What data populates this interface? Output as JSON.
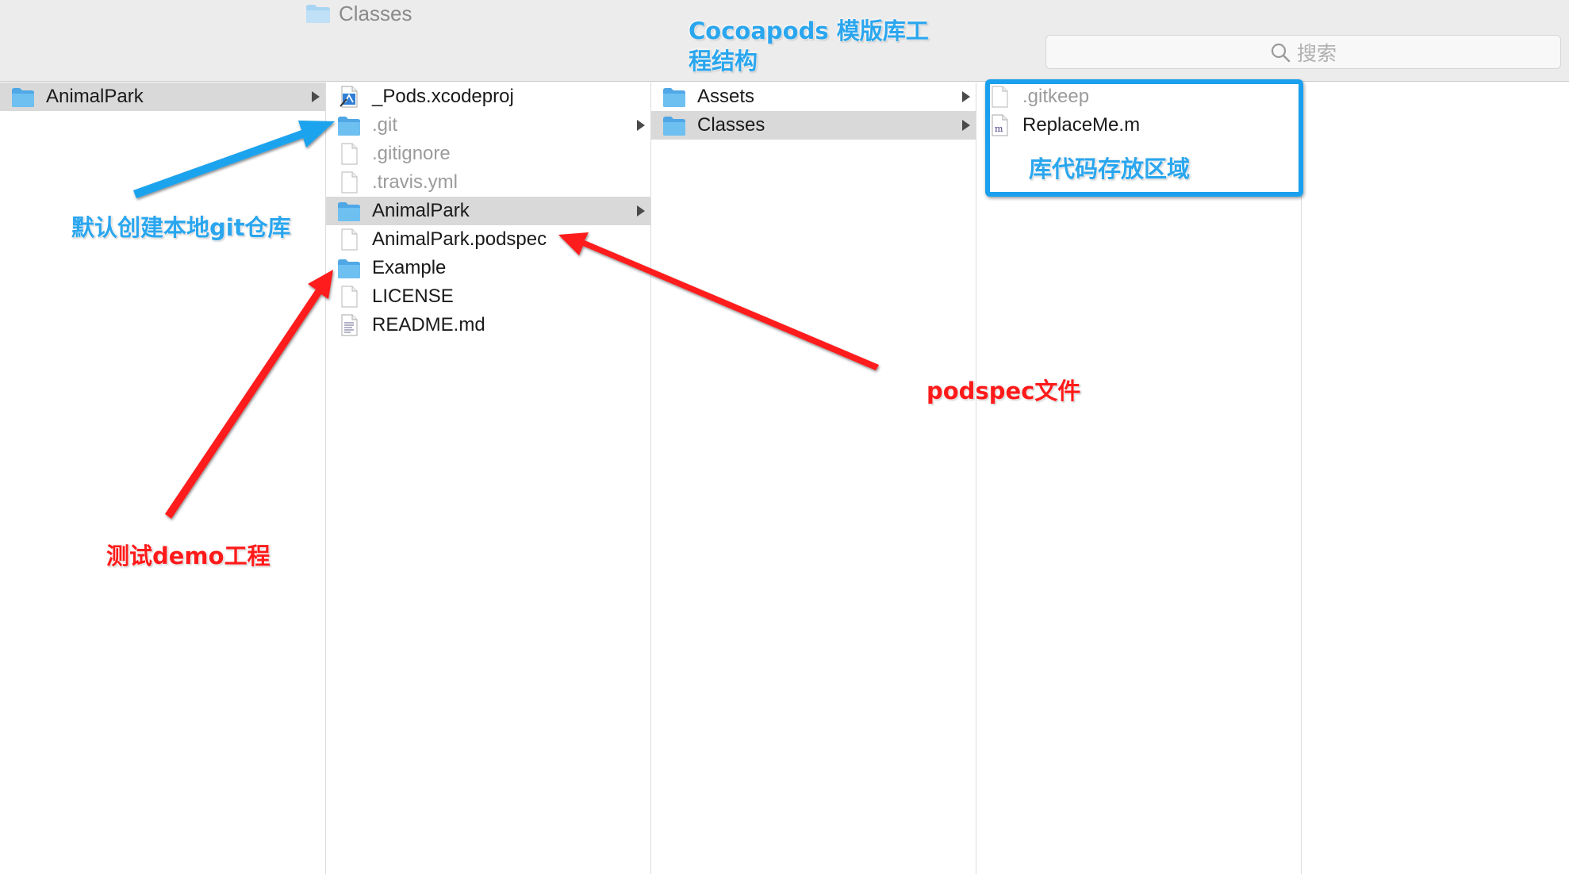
{
  "toolbar": {
    "title": "Classes",
    "search_placeholder": "搜索"
  },
  "columns": [
    {
      "items": [
        {
          "label": "AnimalPark",
          "icon": "folder-icon",
          "selected": true,
          "has_children": true,
          "dim": false
        }
      ]
    },
    {
      "items": [
        {
          "label": "_Pods.xcodeproj",
          "icon": "xcodeproj-icon",
          "selected": false,
          "has_children": false,
          "dim": false
        },
        {
          "label": ".git",
          "icon": "folder-icon",
          "selected": false,
          "has_children": true,
          "dim": true
        },
        {
          "label": ".gitignore",
          "icon": "file-icon",
          "selected": false,
          "has_children": false,
          "dim": true
        },
        {
          "label": ".travis.yml",
          "icon": "file-icon",
          "selected": false,
          "has_children": false,
          "dim": true
        },
        {
          "label": "AnimalPark",
          "icon": "folder-icon",
          "selected": true,
          "has_children": true,
          "dim": false
        },
        {
          "label": "AnimalPark.podspec",
          "icon": "file-icon",
          "selected": false,
          "has_children": false,
          "dim": false
        },
        {
          "label": "Example",
          "icon": "folder-icon",
          "selected": false,
          "has_children": false,
          "dim": false
        },
        {
          "label": "LICENSE",
          "icon": "file-icon",
          "selected": false,
          "has_children": false,
          "dim": false
        },
        {
          "label": "README.md",
          "icon": "text-file-icon",
          "selected": false,
          "has_children": false,
          "dim": false
        }
      ]
    },
    {
      "items": [
        {
          "label": "Assets",
          "icon": "folder-icon",
          "selected": false,
          "has_children": true,
          "dim": false
        },
        {
          "label": "Classes",
          "icon": "folder-icon",
          "selected": true,
          "has_children": true,
          "dim": false
        }
      ]
    },
    {
      "items": [
        {
          "label": ".gitkeep",
          "icon": "file-icon",
          "selected": false,
          "has_children": false,
          "dim": true
        },
        {
          "label": "ReplaceMe.m",
          "icon": "objc-file-icon",
          "selected": false,
          "has_children": false,
          "dim": false
        }
      ]
    }
  ],
  "annotations": {
    "template_structure": "Cocoapods 模版库工\n程结构",
    "git_repo": "默认创建本地git仓库",
    "podspec_file": "podspec文件",
    "demo_project": "测试demo工程",
    "code_area": "库代码存放区域"
  },
  "colors": {
    "annotation_blue": "#2aa6ee",
    "annotation_red": "#ff1a1a",
    "folder_blue": "#5fb6ee",
    "selection_gray": "#d9d9d9"
  }
}
